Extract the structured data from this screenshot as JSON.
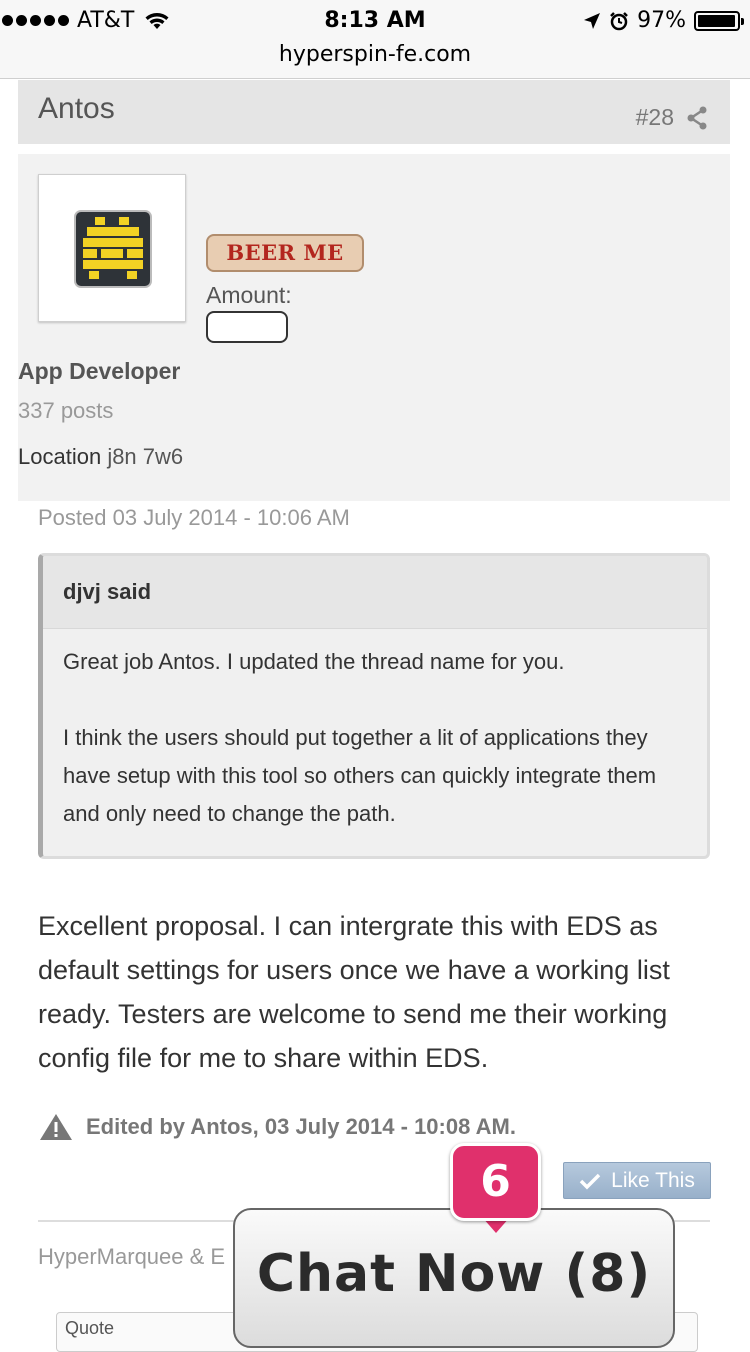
{
  "status_bar": {
    "carrier": "AT&T",
    "time": "8:13 AM",
    "battery": "97%"
  },
  "browser": {
    "url": "hyperspin-fe.com"
  },
  "post": {
    "author": "Antos",
    "post_number": "#28",
    "beer_me_label": "BEER ME",
    "amount_label": "Amount:",
    "user_title": "App Developer",
    "post_count": "337 posts",
    "location_label": "Location",
    "location_value": "j8n 7w6",
    "posted_date": "Posted 03 July 2014 - 10:06 AM",
    "quote": {
      "author": "djvj said",
      "paragraphs": [
        "Great job Antos. I updated the thread name for you.",
        "I think the users should put together a lit of applications they have setup with this tool so others can quickly integrate them and only need to change the path."
      ]
    },
    "body": "Excellent proposal. I can intergrate this with EDS as default settings for users once we have a working list ready. Testers are welcome to send me their working config file for me to share within EDS.",
    "edited_note": "Edited by Antos, 03 July 2014 - 10:08 AM.",
    "like_label": "Like This",
    "signature": "HyperMarquee & E",
    "quote_button": "Quote"
  },
  "chat": {
    "label": "Chat Now (8)",
    "badge_count": "6",
    "badge_color": "#e0306c"
  }
}
